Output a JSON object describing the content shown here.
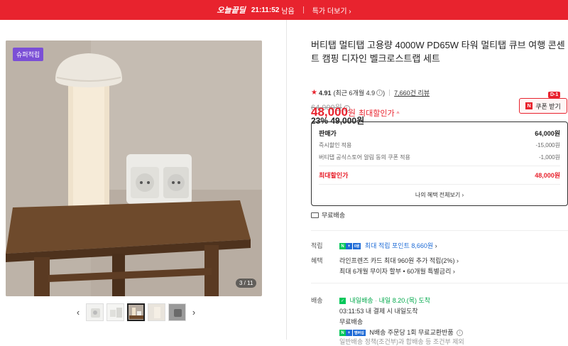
{
  "topbar": {
    "logo": "오늘끝딜",
    "timer": "21:11:52",
    "timer_suffix": "남음",
    "more_label": "특가 더보기"
  },
  "gallery": {
    "badge": "슈퍼적립",
    "counter": "3 / 11",
    "thumb_count": 5,
    "active_thumb": 3
  },
  "product": {
    "title": "버티탭 멀티탭 고용량 4000W PD65W 타워 멀티탭 큐브 여행 콘센트 캠핑 디자인 벨크로스트랩 세트",
    "rating": "4.91",
    "rating_detail": "(최근 6개월 4.9",
    "rating_close": ")",
    "reviews": "7,660건 리뷰",
    "original_price": "64,000원",
    "sale_pct": "23%",
    "sale_price": "49,000원",
    "best_price": "48,000",
    "best_won": "원",
    "best_label": "최대할인가",
    "coupon_label": "쿠폰 받기",
    "coupon_dday": "D-1"
  },
  "price_box": {
    "rows": [
      {
        "label": "판매가",
        "value": "64,000원"
      },
      {
        "label": "즉시할인 적용",
        "value": "-15,000원"
      },
      {
        "label": "버티탭 공식스토어 알림 동의 쿠폰 적용",
        "value": "-1,000원"
      }
    ],
    "total_label": "최대할인가",
    "total_value": "48,000원",
    "more_label": "나의 혜택 전체보기"
  },
  "shipping_free": "무료배송",
  "benefits": {
    "points_label": "적립",
    "points_badge": "N+ 0원",
    "points_text": "최대 적립 포인트 8,660원",
    "perks_label": "혜택",
    "perks": [
      "라인프렌즈 카드 최대 960원 추가 적립(2%)",
      "최대 6개월 무이자 할부 • 60개월 특별금리"
    ]
  },
  "delivery": {
    "label": "배송",
    "badge": "내일배송",
    "arrival": "내일 8.20.(목) 도착",
    "cutoff": "03:11:53",
    "cutoff_text": "내 결제 시 내일도착",
    "fee": "무료배송",
    "membership_badge": "멤버십",
    "membership_text": "N배송 주문당 1회 무료교환반품",
    "extra_text": "일반배송 정책(조건부)과 합배송 등 조건부 제외"
  },
  "colors": {
    "accent": "#e8232e",
    "badge_purple": "#7b4fd6",
    "naver_green": "#03c75a",
    "link_blue": "#1e6bd6"
  }
}
